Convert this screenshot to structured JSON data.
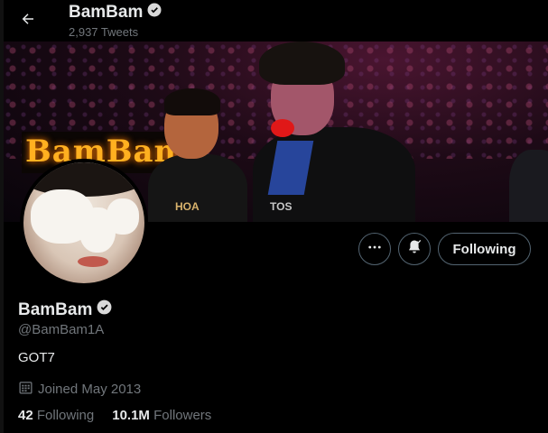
{
  "header": {
    "name": "BamBam",
    "tweet_count": "2,937 Tweets"
  },
  "banner": {
    "sign_text": "BamBam",
    "shirt_text_left": "HOA",
    "shirt_text_right": "TOS"
  },
  "actions": {
    "more_icon": "more-dots-icon",
    "notify_icon": "bell-check-icon",
    "following_label": "Following"
  },
  "profile": {
    "display_name": "BamBam",
    "handle": "@BamBam1A",
    "bio": "GOT7",
    "joined": "Joined May 2013",
    "following_count": "42",
    "following_label": "Following",
    "followers_count": "10.1M",
    "followers_label": "Followers"
  },
  "colors": {
    "background": "#000000",
    "text_primary": "#e7e9ea",
    "text_secondary": "#71767b",
    "verified_badge": "#ffffff",
    "button_border": "#536471"
  }
}
